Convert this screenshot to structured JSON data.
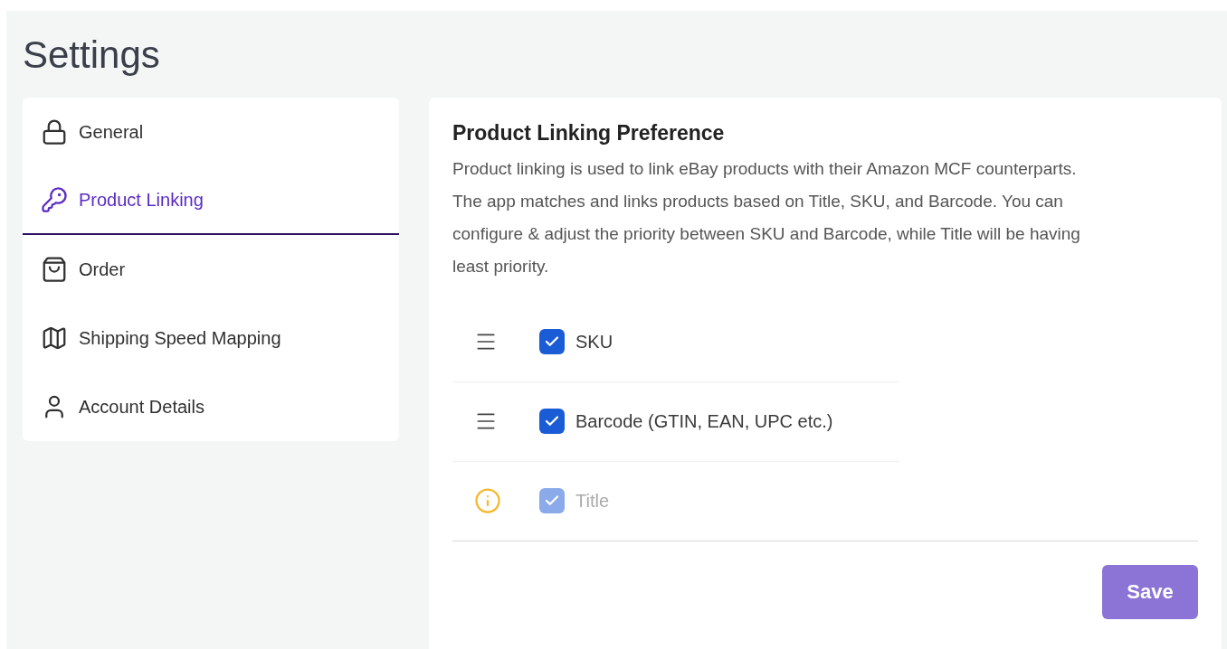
{
  "page": {
    "title": "Settings"
  },
  "sidebar": {
    "items": [
      {
        "label": "General",
        "selected": false
      },
      {
        "label": "Product Linking",
        "selected": true
      },
      {
        "label": "Order",
        "selected": false
      },
      {
        "label": "Shipping Speed Mapping",
        "selected": false
      },
      {
        "label": "Account Details",
        "selected": false
      }
    ]
  },
  "panel": {
    "heading": "Product Linking Preference",
    "description": "Product linking is used to link eBay products with their Amazon MCF counterparts. The app matches and links products based on Title, SKU, and Barcode. You can configure & adjust the priority between SKU and Barcode, while Title will be having least priority.",
    "options": [
      {
        "kind": "drag",
        "label": "SKU",
        "checked": true,
        "disabled": false
      },
      {
        "kind": "drag",
        "label": "Barcode (GTIN, EAN, UPC etc.)",
        "checked": true,
        "disabled": false
      },
      {
        "kind": "info",
        "label": "Title",
        "checked": true,
        "disabled": true
      }
    ],
    "save_button": {
      "label": "Save",
      "disabled": true
    }
  }
}
